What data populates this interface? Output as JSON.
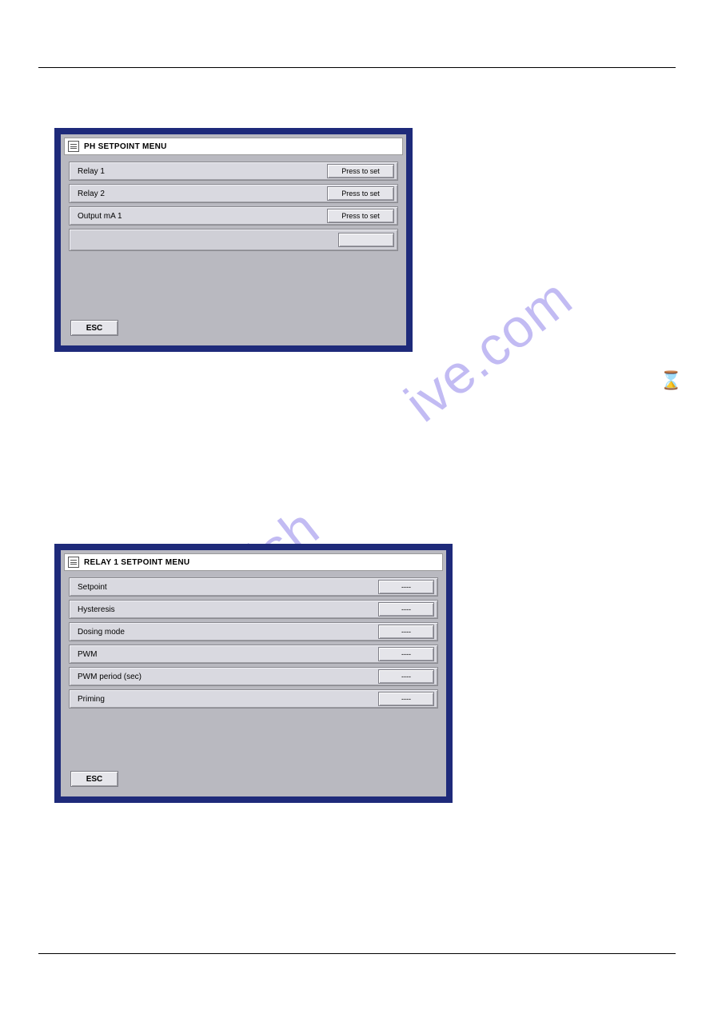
{
  "watermark": {
    "part1": "manualsh",
    "part2": "ive.com"
  },
  "hourglass_glyph": "⌛",
  "panel1": {
    "title": "PH SETPOINT MENU",
    "rows": [
      {
        "label": "Relay 1",
        "button": "Press to set"
      },
      {
        "label": "Relay 2",
        "button": "Press to set"
      },
      {
        "label": "Output mA 1",
        "button": "Press to set"
      },
      {
        "label": "",
        "button": ""
      }
    ],
    "esc": "ESC"
  },
  "panel2": {
    "title": "RELAY 1 SETPOINT MENU",
    "rows": [
      {
        "label": "Setpoint",
        "button": "----"
      },
      {
        "label": "Hysteresis",
        "button": "----"
      },
      {
        "label": "Dosing mode",
        "button": "----"
      },
      {
        "label": "PWM",
        "button": "----"
      },
      {
        "label": "PWM period (sec)",
        "button": "----"
      },
      {
        "label": "Priming",
        "button": "----"
      }
    ],
    "esc": "ESC"
  }
}
